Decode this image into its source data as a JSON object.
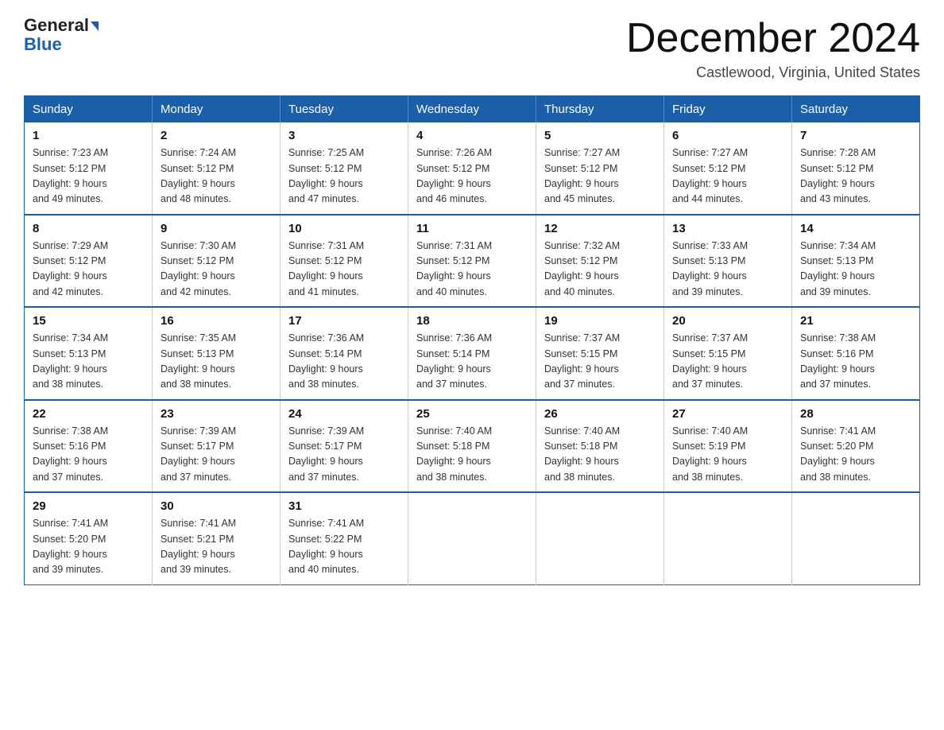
{
  "header": {
    "logo_general": "General",
    "logo_blue": "Blue",
    "month_title": "December 2024",
    "location": "Castlewood, Virginia, United States"
  },
  "days_of_week": [
    "Sunday",
    "Monday",
    "Tuesday",
    "Wednesday",
    "Thursday",
    "Friday",
    "Saturday"
  ],
  "weeks": [
    [
      {
        "day": "1",
        "sunrise": "7:23 AM",
        "sunset": "5:12 PM",
        "daylight": "9 hours and 49 minutes."
      },
      {
        "day": "2",
        "sunrise": "7:24 AM",
        "sunset": "5:12 PM",
        "daylight": "9 hours and 48 minutes."
      },
      {
        "day": "3",
        "sunrise": "7:25 AM",
        "sunset": "5:12 PM",
        "daylight": "9 hours and 47 minutes."
      },
      {
        "day": "4",
        "sunrise": "7:26 AM",
        "sunset": "5:12 PM",
        "daylight": "9 hours and 46 minutes."
      },
      {
        "day": "5",
        "sunrise": "7:27 AM",
        "sunset": "5:12 PM",
        "daylight": "9 hours and 45 minutes."
      },
      {
        "day": "6",
        "sunrise": "7:27 AM",
        "sunset": "5:12 PM",
        "daylight": "9 hours and 44 minutes."
      },
      {
        "day": "7",
        "sunrise": "7:28 AM",
        "sunset": "5:12 PM",
        "daylight": "9 hours and 43 minutes."
      }
    ],
    [
      {
        "day": "8",
        "sunrise": "7:29 AM",
        "sunset": "5:12 PM",
        "daylight": "9 hours and 42 minutes."
      },
      {
        "day": "9",
        "sunrise": "7:30 AM",
        "sunset": "5:12 PM",
        "daylight": "9 hours and 42 minutes."
      },
      {
        "day": "10",
        "sunrise": "7:31 AM",
        "sunset": "5:12 PM",
        "daylight": "9 hours and 41 minutes."
      },
      {
        "day": "11",
        "sunrise": "7:31 AM",
        "sunset": "5:12 PM",
        "daylight": "9 hours and 40 minutes."
      },
      {
        "day": "12",
        "sunrise": "7:32 AM",
        "sunset": "5:12 PM",
        "daylight": "9 hours and 40 minutes."
      },
      {
        "day": "13",
        "sunrise": "7:33 AM",
        "sunset": "5:13 PM",
        "daylight": "9 hours and 39 minutes."
      },
      {
        "day": "14",
        "sunrise": "7:34 AM",
        "sunset": "5:13 PM",
        "daylight": "9 hours and 39 minutes."
      }
    ],
    [
      {
        "day": "15",
        "sunrise": "7:34 AM",
        "sunset": "5:13 PM",
        "daylight": "9 hours and 38 minutes."
      },
      {
        "day": "16",
        "sunrise": "7:35 AM",
        "sunset": "5:13 PM",
        "daylight": "9 hours and 38 minutes."
      },
      {
        "day": "17",
        "sunrise": "7:36 AM",
        "sunset": "5:14 PM",
        "daylight": "9 hours and 38 minutes."
      },
      {
        "day": "18",
        "sunrise": "7:36 AM",
        "sunset": "5:14 PM",
        "daylight": "9 hours and 37 minutes."
      },
      {
        "day": "19",
        "sunrise": "7:37 AM",
        "sunset": "5:15 PM",
        "daylight": "9 hours and 37 minutes."
      },
      {
        "day": "20",
        "sunrise": "7:37 AM",
        "sunset": "5:15 PM",
        "daylight": "9 hours and 37 minutes."
      },
      {
        "day": "21",
        "sunrise": "7:38 AM",
        "sunset": "5:16 PM",
        "daylight": "9 hours and 37 minutes."
      }
    ],
    [
      {
        "day": "22",
        "sunrise": "7:38 AM",
        "sunset": "5:16 PM",
        "daylight": "9 hours and 37 minutes."
      },
      {
        "day": "23",
        "sunrise": "7:39 AM",
        "sunset": "5:17 PM",
        "daylight": "9 hours and 37 minutes."
      },
      {
        "day": "24",
        "sunrise": "7:39 AM",
        "sunset": "5:17 PM",
        "daylight": "9 hours and 37 minutes."
      },
      {
        "day": "25",
        "sunrise": "7:40 AM",
        "sunset": "5:18 PM",
        "daylight": "9 hours and 38 minutes."
      },
      {
        "day": "26",
        "sunrise": "7:40 AM",
        "sunset": "5:18 PM",
        "daylight": "9 hours and 38 minutes."
      },
      {
        "day": "27",
        "sunrise": "7:40 AM",
        "sunset": "5:19 PM",
        "daylight": "9 hours and 38 minutes."
      },
      {
        "day": "28",
        "sunrise": "7:41 AM",
        "sunset": "5:20 PM",
        "daylight": "9 hours and 38 minutes."
      }
    ],
    [
      {
        "day": "29",
        "sunrise": "7:41 AM",
        "sunset": "5:20 PM",
        "daylight": "9 hours and 39 minutes."
      },
      {
        "day": "30",
        "sunrise": "7:41 AM",
        "sunset": "5:21 PM",
        "daylight": "9 hours and 39 minutes."
      },
      {
        "day": "31",
        "sunrise": "7:41 AM",
        "sunset": "5:22 PM",
        "daylight": "9 hours and 40 minutes."
      },
      null,
      null,
      null,
      null
    ]
  ],
  "labels": {
    "sunrise_prefix": "Sunrise: ",
    "sunset_prefix": "Sunset: ",
    "daylight_prefix": "Daylight: "
  }
}
